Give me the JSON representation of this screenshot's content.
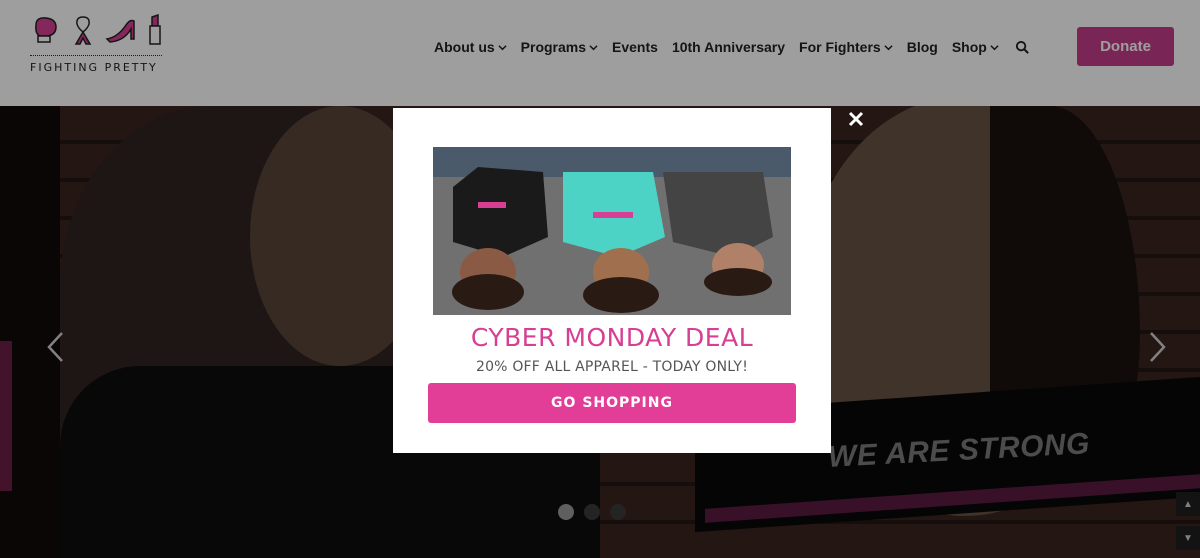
{
  "header": {
    "logo_text": "FIGHTING PRETTY",
    "logo_icons": [
      "boxing-glove-icon",
      "ribbon-icon",
      "high-heel-icon",
      "lipstick-icon"
    ],
    "nav": [
      {
        "label": "About us",
        "has_dropdown": true
      },
      {
        "label": "Programs",
        "has_dropdown": true
      },
      {
        "label": "Events",
        "has_dropdown": false
      },
      {
        "label": "10th Anniversary",
        "has_dropdown": false
      },
      {
        "label": "For Fighters",
        "has_dropdown": true
      },
      {
        "label": "Blog",
        "has_dropdown": false
      },
      {
        "label": "Shop",
        "has_dropdown": true
      }
    ],
    "search_icon": "search-icon",
    "donate_label": "Donate"
  },
  "hero": {
    "slide_heading": "WE ARE STRONG",
    "slide_count": 3,
    "active_slide": 1
  },
  "modal": {
    "title": "CYBER MONDAY DEAL",
    "subtitle": "20% OFF ALL APPAREL - TODAY ONLY!",
    "cta_label": "GO SHOPPING",
    "shirt_text": "FIGHTING PRETTY"
  },
  "colors": {
    "brand_pink": "#c43d8a",
    "cta_pink": "#e23e97",
    "title_pink": "#d63f93",
    "header_bg": "#ffffff"
  }
}
